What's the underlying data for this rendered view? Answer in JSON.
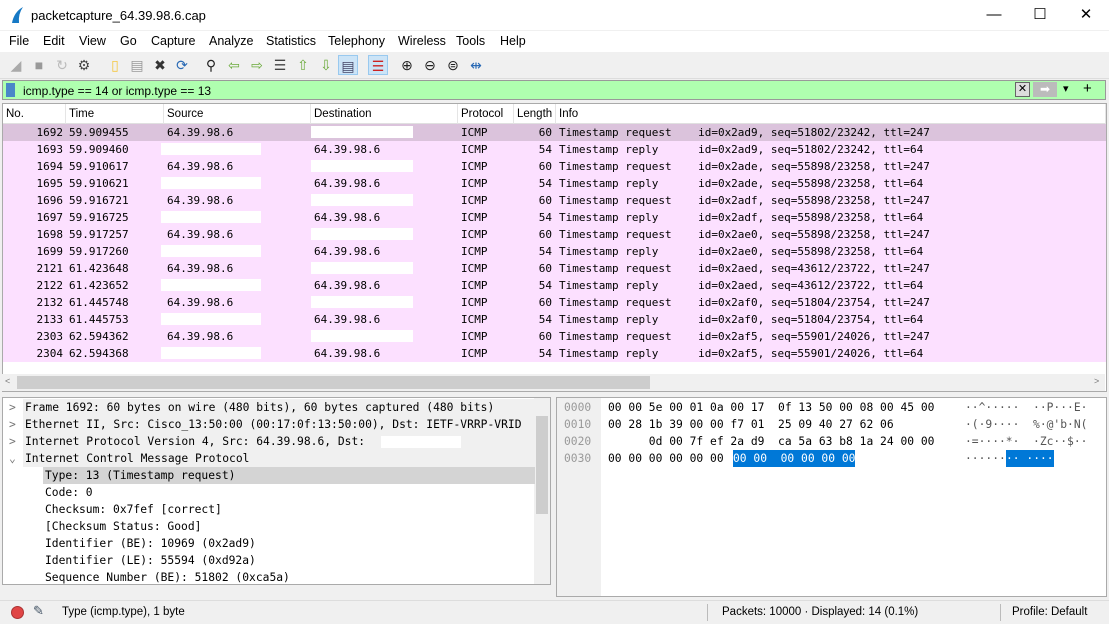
{
  "window": {
    "title": "packetcapture_64.39.98.6.cap",
    "minimize": "—",
    "maximize": "☐",
    "close": "✕"
  },
  "menu": [
    "File",
    "Edit",
    "View",
    "Go",
    "Capture",
    "Analyze",
    "Statistics",
    "Telephony",
    "Wireless",
    "Tools",
    "Help"
  ],
  "toolbar": [
    "shark-fin-start-icon",
    "stop-icon",
    "restart-icon",
    "options-gear-icon",
    "open-folder-icon",
    "save-file-icon",
    "close-file-icon",
    "reload-icon",
    "find-icon",
    "back-arrow-icon",
    "forward-arrow-icon",
    "go-to-packet-icon",
    "first-packet-icon",
    "last-packet-icon",
    "autoscroll-icon",
    "colorize-icon",
    "zoom-in-icon",
    "zoom-out-icon",
    "zoom-normal-icon",
    "resize-columns-icon"
  ],
  "filter": {
    "value": "icmp.type == 14 or icmp.type == 13",
    "clear": "✕",
    "apply": "➡",
    "dropdown": "▾",
    "add": "+",
    "bg_color": "#afffaf"
  },
  "columns": [
    "No.",
    "Time",
    "Source",
    "Destination",
    "Protocol",
    "Length",
    "Info"
  ],
  "colors": {
    "row": "#fce0ff",
    "selected_row": "#dbc3dc",
    "hex_selection": "#0078d7"
  },
  "packets": [
    {
      "no": "1692",
      "time": "59.909455",
      "src": "64.39.98.6",
      "dst": "",
      "proto": "ICMP",
      "len": "60",
      "info": "Timestamp request    id=0x2ad9, seq=51802/23242, ttl=247",
      "selected": true
    },
    {
      "no": "1693",
      "time": "59.909460",
      "src": "",
      "dst": "64.39.98.6",
      "proto": "ICMP",
      "len": "54",
      "info": "Timestamp reply      id=0x2ad9, seq=51802/23242, ttl=64"
    },
    {
      "no": "1694",
      "time": "59.910617",
      "src": "64.39.98.6",
      "dst": "",
      "proto": "ICMP",
      "len": "60",
      "info": "Timestamp request    id=0x2ade, seq=55898/23258, ttl=247"
    },
    {
      "no": "1695",
      "time": "59.910621",
      "src": "",
      "dst": "64.39.98.6",
      "proto": "ICMP",
      "len": "54",
      "info": "Timestamp reply      id=0x2ade, seq=55898/23258, ttl=64"
    },
    {
      "no": "1696",
      "time": "59.916721",
      "src": "64.39.98.6",
      "dst": "",
      "proto": "ICMP",
      "len": "60",
      "info": "Timestamp request    id=0x2adf, seq=55898/23258, ttl=247"
    },
    {
      "no": "1697",
      "time": "59.916725",
      "src": "",
      "dst": "64.39.98.6",
      "proto": "ICMP",
      "len": "54",
      "info": "Timestamp reply      id=0x2adf, seq=55898/23258, ttl=64"
    },
    {
      "no": "1698",
      "time": "59.917257",
      "src": "64.39.98.6",
      "dst": "",
      "proto": "ICMP",
      "len": "60",
      "info": "Timestamp request    id=0x2ae0, seq=55898/23258, ttl=247"
    },
    {
      "no": "1699",
      "time": "59.917260",
      "src": "",
      "dst": "64.39.98.6",
      "proto": "ICMP",
      "len": "54",
      "info": "Timestamp reply      id=0x2ae0, seq=55898/23258, ttl=64"
    },
    {
      "no": "2121",
      "time": "61.423648",
      "src": "64.39.98.6",
      "dst": "",
      "proto": "ICMP",
      "len": "60",
      "info": "Timestamp request    id=0x2aed, seq=43612/23722, ttl=247"
    },
    {
      "no": "2122",
      "time": "61.423652",
      "src": "",
      "dst": "64.39.98.6",
      "proto": "ICMP",
      "len": "54",
      "info": "Timestamp reply      id=0x2aed, seq=43612/23722, ttl=64"
    },
    {
      "no": "2132",
      "time": "61.445748",
      "src": "64.39.98.6",
      "dst": "",
      "proto": "ICMP",
      "len": "60",
      "info": "Timestamp request    id=0x2af0, seq=51804/23754, ttl=247"
    },
    {
      "no": "2133",
      "time": "61.445753",
      "src": "",
      "dst": "64.39.98.6",
      "proto": "ICMP",
      "len": "54",
      "info": "Timestamp reply      id=0x2af0, seq=51804/23754, ttl=64"
    },
    {
      "no": "2303",
      "time": "62.594362",
      "src": "64.39.98.6",
      "dst": "",
      "proto": "ICMP",
      "len": "60",
      "info": "Timestamp request    id=0x2af5, seq=55901/24026, ttl=247"
    },
    {
      "no": "2304",
      "time": "62.594368",
      "src": "",
      "dst": "64.39.98.6",
      "proto": "ICMP",
      "len": "54",
      "info": "Timestamp reply      id=0x2af5, seq=55901/24026, ttl=64"
    }
  ],
  "details": [
    {
      "text": "Frame 1692: 60 bytes on wire (480 bits), 60 bytes captured (480 bits)",
      "level": 0,
      "arrow": ">"
    },
    {
      "text": "Ethernet II, Src: Cisco_13:50:00 (00:17:0f:13:50:00), Dst: IETF-VRRP-VRID",
      "level": 0,
      "arrow": ">"
    },
    {
      "text": "Internet Protocol Version 4, Src: 64.39.98.6, Dst:",
      "level": 0,
      "arrow": ">"
    },
    {
      "text": "Internet Control Message Protocol",
      "level": 0,
      "arrow": "⌄"
    },
    {
      "text": "Type: 13 (Timestamp request)",
      "level": 1,
      "selected": true
    },
    {
      "text": "Code: 0",
      "level": 1
    },
    {
      "text": "Checksum: 0x7fef [correct]",
      "level": 1
    },
    {
      "text": "[Checksum Status: Good]",
      "level": 1
    },
    {
      "text": "Identifier (BE): 10969 (0x2ad9)",
      "level": 1
    },
    {
      "text": "Identifier (LE): 55594 (0xd92a)",
      "level": 1
    },
    {
      "text": "Sequence Number (BE): 51802 (0xca5a)",
      "level": 1
    }
  ],
  "hex": [
    {
      "off": "0000",
      "bytes": "00 00 5e 00 01 0a 00 17  0f 13 50 00 08 00 45 00",
      "ascii": "··^·····  ··P···E·"
    },
    {
      "off": "0010",
      "bytes": "00 28 1b 39 00 00 f7 01  25 09 40 27 62 06",
      "ascii": "·(·9····  %·@'b·N("
    },
    {
      "off": "0020",
      "bytes": "      0d 00 7f ef 2a d9  ca 5a 63 b8 1a 24 00 00",
      "ascii": "·=····*·  ·Zc··$··"
    },
    {
      "off": "0030",
      "bytes": "00 00 00 00 00 00 ",
      "bytes_sel": "00 00  00 00 00 00",
      "ascii": "········",
      "ascii_sel": "·· ····"
    }
  ],
  "status": {
    "field": "Type (icmp.type), 1 byte",
    "packets": "Packets: 10000 · Displayed: 14 (0.1%)",
    "profile": "Profile: Default"
  }
}
